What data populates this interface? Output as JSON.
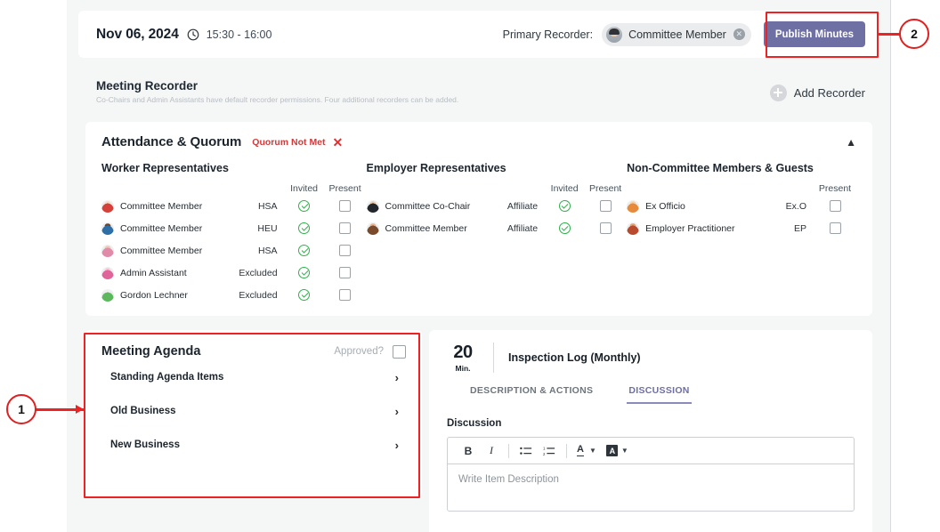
{
  "topbar": {
    "date": "Nov 06, 2024",
    "clock_icon": "clock-icon",
    "time_range": "15:30 - 16:00",
    "primary_recorder_label": "Primary Recorder:",
    "recorder_chip_name": "Committee Member",
    "recorder_chip_remove_icon": "close-circle-icon",
    "publish_button": "Publish Minutes",
    "accent_color": "#6e6fa3"
  },
  "recorder_strip": {
    "title": "Meeting Recorder",
    "subtitle": "Co-Chairs and Admin Assistants have default recorder permissions. Four additional recorders can be added.",
    "add_recorder_label": "Add Recorder",
    "add_icon": "plus-circle-icon"
  },
  "attendance": {
    "title": "Attendance & Quorum",
    "quorum_badge": "Quorum Not Met",
    "quorum_badge_color": "#d03a3a",
    "dismiss_icon": "close-x-icon",
    "collapse_icon": "chevron-up-icon",
    "columns": [
      {
        "title": "Worker Representatives",
        "headers": [
          "Invited",
          "Present"
        ],
        "rows": [
          {
            "avatar": "avatar-red-cap",
            "name": "Committee Member",
            "role": "HSA",
            "invited": true,
            "present": false
          },
          {
            "avatar": "avatar-blue-shirt",
            "name": "Committee Member",
            "role": "HEU",
            "invited": true,
            "present": false
          },
          {
            "avatar": "avatar-pink-hair",
            "name": "Committee Member",
            "role": "HSA",
            "invited": true,
            "present": false
          },
          {
            "avatar": "avatar-pink-figure",
            "name": "Admin Assistant",
            "role": "Excluded",
            "invited": true,
            "present": false
          },
          {
            "avatar": "avatar-multicolor-logo",
            "name": "Gordon Lechner",
            "role": "Excluded",
            "invited": true,
            "present": false
          }
        ]
      },
      {
        "title": "Employer Representatives",
        "headers": [
          "Invited",
          "Present"
        ],
        "rows": [
          {
            "avatar": "avatar-dark-hair",
            "name": "Committee Co-Chair",
            "role": "Affiliate",
            "invited": true,
            "present": false
          },
          {
            "avatar": "avatar-brown-hair",
            "name": "Committee Member",
            "role": "Affiliate",
            "invited": true,
            "present": false
          }
        ]
      },
      {
        "title": "Non-Committee Members & Guests",
        "headers": [
          "Present"
        ],
        "rows": [
          {
            "avatar": "avatar-orange",
            "name": "Ex Officio",
            "role": "Ex.O",
            "present": false
          },
          {
            "avatar": "avatar-teal",
            "name": "Employer Practitioner",
            "role": "EP",
            "present": false
          }
        ]
      }
    ]
  },
  "agenda": {
    "title": "Meeting Agenda",
    "approved_label": "Approved?",
    "approved_checked": false,
    "items": [
      {
        "label": "Standing Agenda Items",
        "chevron": "chevron-right-icon"
      },
      {
        "label": "Old Business",
        "chevron": "chevron-right-icon"
      },
      {
        "label": "New Business",
        "chevron": "chevron-right-icon"
      }
    ]
  },
  "detail": {
    "duration_value": "20",
    "duration_unit": "Min.",
    "title": "Inspection Log (Monthly)",
    "tabs": [
      {
        "label": "DESCRIPTION & ACTIONS",
        "active": false
      },
      {
        "label": "DISCUSSION",
        "active": true
      }
    ],
    "field_label": "Discussion",
    "editor": {
      "tools": [
        {
          "name": "bold-icon",
          "glyph": "B"
        },
        {
          "name": "italic-icon",
          "glyph": "I"
        },
        {
          "name": "bullet-list-icon",
          "glyph": "≔"
        },
        {
          "name": "numbered-list-icon",
          "glyph": "≕"
        },
        {
          "name": "text-color-icon",
          "glyph": "A"
        },
        {
          "name": "highlight-color-icon",
          "glyph": "A"
        }
      ],
      "placeholder": "Write Item Description",
      "value": ""
    }
  },
  "annotations": [
    {
      "number": "1",
      "target": "meeting-agenda-card"
    },
    {
      "number": "2",
      "target": "publish-minutes-button"
    }
  ]
}
